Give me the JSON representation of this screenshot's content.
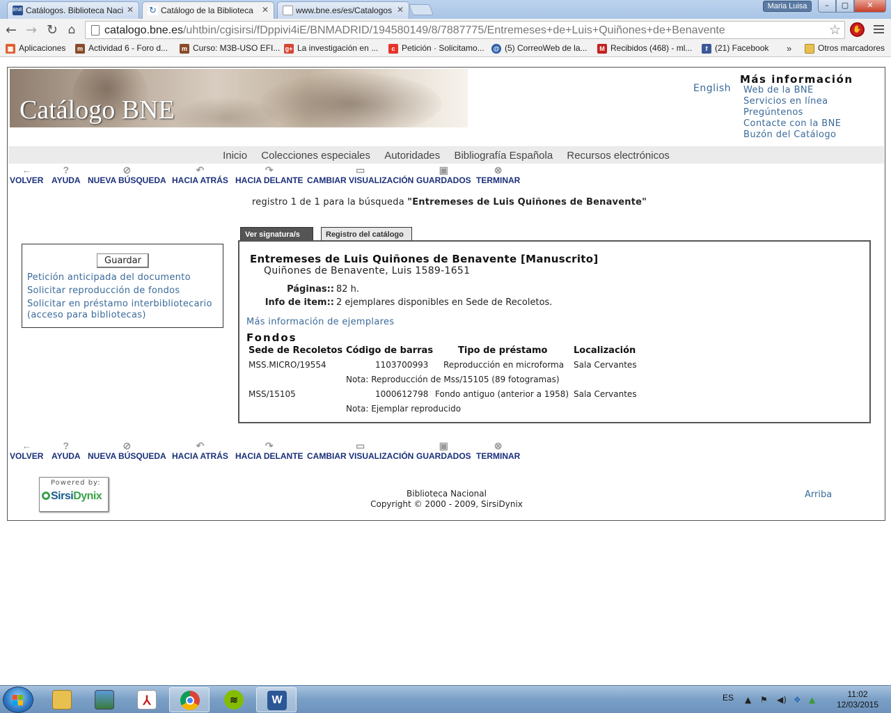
{
  "browser": {
    "tabs": [
      {
        "title": "Catálogos. Biblioteca Naci",
        "favicon": "bne-favicon"
      },
      {
        "title": "Catálogo de la Biblioteca",
        "favicon": "loading-favicon"
      },
      {
        "title": "www.bne.es/es/Catalogos",
        "favicon": "page-favicon"
      }
    ],
    "user_name": "Maria Luisa",
    "url_host": "catalogo.bne.es",
    "url_path": "/uhtbin/cgisirsi/fDppivi4iE/BNMADRID/194580149/8/7887775/Entremeses+de+Luis+Quiñones+de+Benavente",
    "bookmarks": [
      {
        "label": "Aplicaciones",
        "icon": "apps-icon",
        "color": "#e06030"
      },
      {
        "label": "Actividad 6 - Foro d...",
        "icon": "moodle-icon",
        "color": "#8a4b2a"
      },
      {
        "label": "Curso: M3B-USO EFI...",
        "icon": "moodle-icon",
        "color": "#8a4b2a"
      },
      {
        "label": "La investigación en ...",
        "icon": "google-plus-icon",
        "color": "#d34836"
      },
      {
        "label": "Petición · Solicitamo...",
        "icon": "change-org-icon",
        "color": "#e8332a"
      },
      {
        "label": "(5) CorreoWeb de la...",
        "icon": "mail-icon",
        "color": "#2a5da8"
      },
      {
        "label": "Recibidos (468) - ml...",
        "icon": "gmail-icon",
        "color": "#c5221f"
      },
      {
        "label": "(21) Facebook",
        "icon": "facebook-icon",
        "color": "#3b5998"
      }
    ],
    "bookmarks_more": "»",
    "other_bookmarks": "Otros marcadores"
  },
  "header": {
    "title": "Catálogo BNE",
    "language_link": "English",
    "more_info_title": "Más información",
    "more_info_links": [
      "Web de la BNE",
      "Servicios en línea",
      "Pregúntenos",
      "Contacte con la BNE",
      "Buzón del Catálogo"
    ]
  },
  "main_nav": [
    "Inicio",
    "Colecciones especiales",
    "Autoridades",
    "Bibliografía Española",
    "Recursos electrónicos"
  ],
  "actions": [
    {
      "label": "VOLVER",
      "icon": "back-arrow-icon"
    },
    {
      "label": "AYUDA",
      "icon": "help-icon"
    },
    {
      "label": "NUEVA BÚSQUEDA",
      "icon": "search-icon"
    },
    {
      "label": "HACIA ATRÁS",
      "icon": "previous-icon"
    },
    {
      "label": "HACIA DELANTE",
      "icon": "next-icon"
    },
    {
      "label": "CAMBIAR VISUALIZACIÓN",
      "icon": "display-icon"
    },
    {
      "label": "GUARDADOS",
      "icon": "save-icon"
    },
    {
      "label": "TERMINAR",
      "icon": "close-icon"
    }
  ],
  "result": {
    "prefix": "registro 1 de 1 para la búsqueda",
    "query": "\"Entremeses de Luis Quiñones de Benavente\""
  },
  "sidebar": {
    "save_button": "Guardar",
    "links": [
      "Petición anticipada del documento",
      "Solicitar reproducción de fondos",
      "Solicitar en préstamo interbibliotecario (acceso para bibliotecas)"
    ]
  },
  "record_tabs": [
    "Ver signatura/s",
    "Registro del catálogo"
  ],
  "record": {
    "title": "Entremeses de Luis Quiñones de Benavente [Manuscrito]",
    "author": "Quiñones de Benavente, Luis 1589-1651",
    "fields": [
      {
        "label": "Páginas::",
        "value": "82 h."
      },
      {
        "label": "Info de item::",
        "value": "2 ejemplares disponibles en Sede de Recoletos."
      }
    ],
    "more_copies_link": "Más información de ejemplares",
    "holdings_title": "Fondos",
    "holdings_headers": [
      "Sede de Recoletos",
      "Código de barras",
      "Tipo de préstamo",
      "Localización"
    ],
    "holdings": [
      {
        "call_number": "MSS.MICRO/19554",
        "barcode": "1103700993",
        "loan_type": "Reproducción en microforma",
        "location": "Sala Cervantes",
        "note": "Nota: Reproducción de Mss/15105 (89 fotogramas)"
      },
      {
        "call_number": "MSS/15105",
        "barcode": "1000612798",
        "loan_type": "Fondo antiguo (anterior a 1958)",
        "location": "Sala Cervantes",
        "note": "Nota: Ejemplar reproducido"
      }
    ]
  },
  "footer": {
    "powered_by": "Powered by:",
    "logo_text_a": "Sirsi",
    "logo_text_b": "Dynix",
    "center_line1": "Biblioteca Nacional",
    "center_line2": "Copyright © 2000 - 2009, SirsiDynix",
    "top_link": "Arriba"
  },
  "taskbar": {
    "apps": [
      "file-explorer-icon",
      "photo-viewer-icon",
      "pdf-reader-icon",
      "chrome-icon",
      "spotify-icon",
      "word-icon"
    ],
    "language": "ES",
    "time": "11:02",
    "date": "12/03/2015"
  }
}
